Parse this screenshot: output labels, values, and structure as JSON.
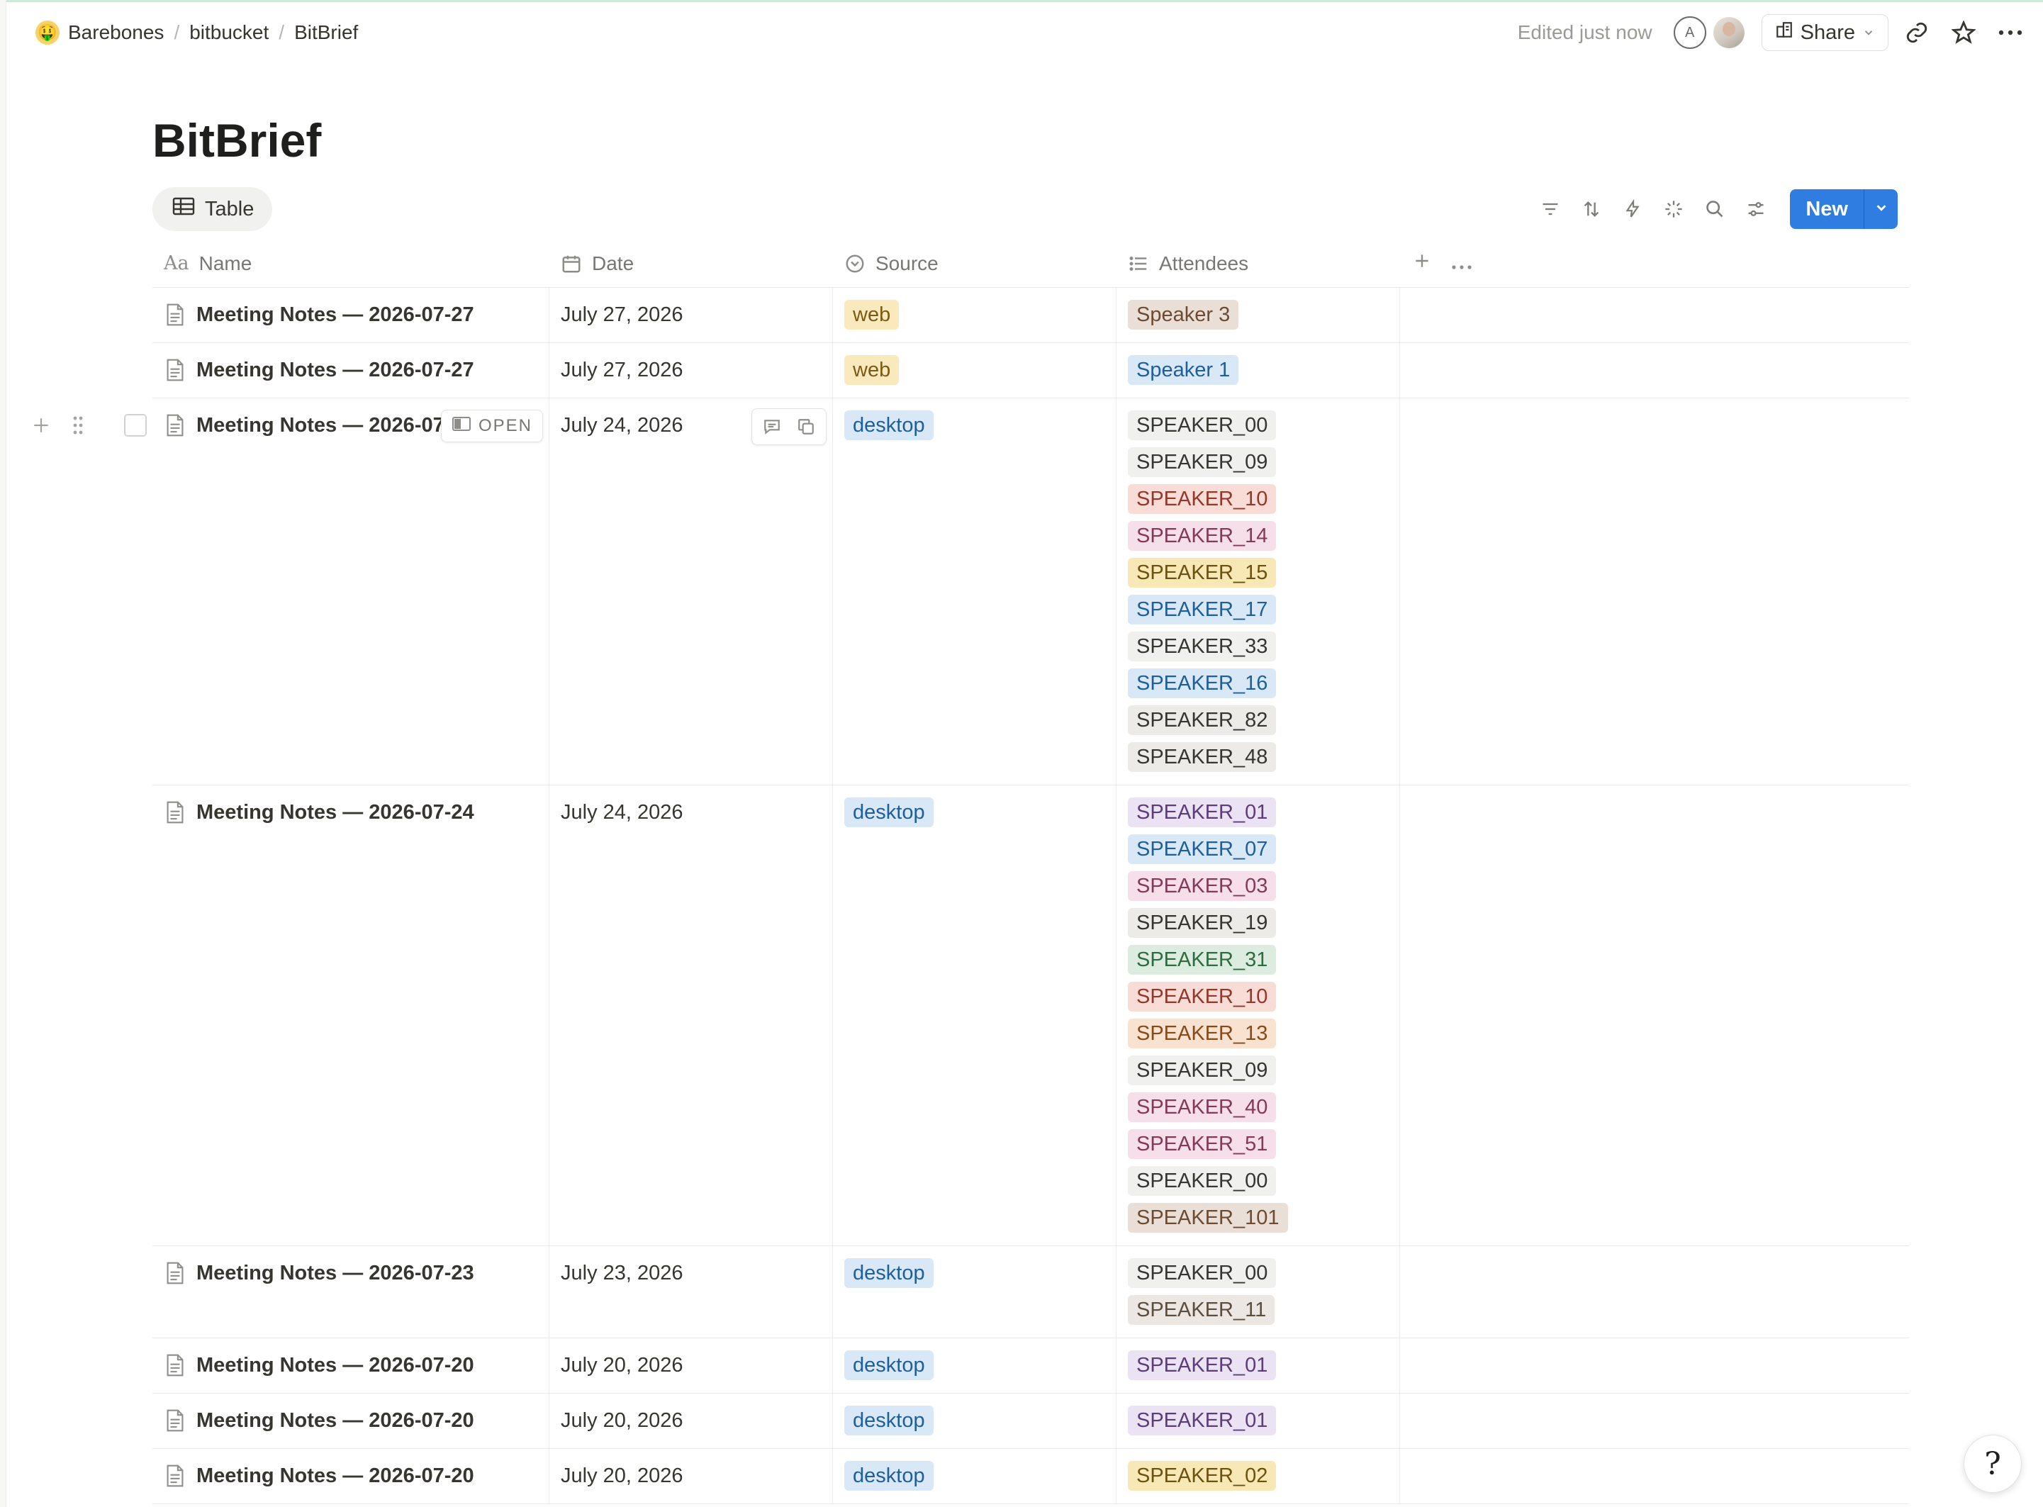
{
  "breadcrumbs": [
    {
      "label": "Barebones",
      "emoji": "🤑"
    },
    {
      "label": "bitbucket"
    },
    {
      "label": "BitBrief"
    }
  ],
  "topbar": {
    "edited": "Edited just now",
    "avatar_initial": "A",
    "share_label": "Share"
  },
  "page": {
    "title": "BitBrief",
    "view_tab": "Table",
    "new_label": "New"
  },
  "columns": {
    "name": "Name",
    "date": "Date",
    "source": "Source",
    "attendees": "Attendees",
    "name_prefix": "Aa"
  },
  "hover": {
    "open_label": "OPEN"
  },
  "rows": [
    {
      "name": "Meeting Notes — 2026-07-27",
      "date": "July 27, 2026",
      "source": "web",
      "attendees": [
        "Speaker 3"
      ]
    },
    {
      "name": "Meeting Notes — 2026-07-27",
      "date": "July 27, 2026",
      "source": "web",
      "attendees": [
        "Speaker 1"
      ]
    },
    {
      "name": "Meeting Notes — 2026-07",
      "date": "July 24, 2026",
      "source": "desktop",
      "attendees": [
        "SPEAKER_00",
        "SPEAKER_09",
        "SPEAKER_10",
        "SPEAKER_14",
        "SPEAKER_15",
        "SPEAKER_17",
        "SPEAKER_33",
        "SPEAKER_16",
        "SPEAKER_82",
        "SPEAKER_48"
      ]
    },
    {
      "name": "Meeting Notes — 2026-07-24",
      "date": "July 24, 2026",
      "source": "desktop",
      "attendees": [
        "SPEAKER_01",
        "SPEAKER_07",
        "SPEAKER_03",
        "SPEAKER_19",
        "SPEAKER_31",
        "SPEAKER_10",
        "SPEAKER_13",
        "SPEAKER_09",
        "SPEAKER_40",
        "SPEAKER_51",
        "SPEAKER_00",
        "SPEAKER_101"
      ]
    },
    {
      "name": "Meeting Notes — 2026-07-23",
      "date": "July 23, 2026",
      "source": "desktop",
      "attendees": [
        "SPEAKER_00",
        "SPEAKER_11"
      ]
    },
    {
      "name": "Meeting Notes — 2026-07-20",
      "date": "July 20, 2026",
      "source": "desktop",
      "attendees": [
        "SPEAKER_01"
      ]
    },
    {
      "name": "Meeting Notes — 2026-07-20",
      "date": "July 20, 2026",
      "source": "desktop",
      "attendees": [
        "SPEAKER_01"
      ]
    },
    {
      "name": "Meeting Notes — 2026-07-20",
      "date": "July 20, 2026",
      "source": "desktop",
      "attendees": [
        "SPEAKER_02"
      ]
    }
  ],
  "tag_colors": {
    "web": {
      "bg": "#f9e9bd",
      "fg": "#7a5a14"
    },
    "desktop": {
      "bg": "#d9e8f7",
      "fg": "#1f5e99"
    },
    "Speaker 3": {
      "bg": "#eadfd6",
      "fg": "#6e4a33"
    },
    "Speaker 1": {
      "bg": "#d9e8f7",
      "fg": "#1f5e99"
    },
    "SPEAKER_00": {
      "bg": "#f0f0ee",
      "fg": "#37352f"
    },
    "SPEAKER_01": {
      "bg": "#ebe2f3",
      "fg": "#5c3d7a"
    },
    "SPEAKER_02": {
      "bg": "#f7e8b6",
      "fg": "#6c5210"
    },
    "SPEAKER_03": {
      "bg": "#f6dfe8",
      "fg": "#84385a"
    },
    "SPEAKER_07": {
      "bg": "#d9e8f7",
      "fg": "#1f5e99"
    },
    "SPEAKER_09": {
      "bg": "#f0f0ee",
      "fg": "#37352f"
    },
    "SPEAKER_10": {
      "bg": "#fadcd6",
      "fg": "#93372b"
    },
    "SPEAKER_11": {
      "bg": "#ece7e2",
      "fg": "#5d4d3e"
    },
    "SPEAKER_13": {
      "bg": "#f9e3d0",
      "fg": "#8a4a17"
    },
    "SPEAKER_14": {
      "bg": "#f6dfe8",
      "fg": "#84385a"
    },
    "SPEAKER_15": {
      "bg": "#f7e8b6",
      "fg": "#6c5210"
    },
    "SPEAKER_16": {
      "bg": "#d9e8f7",
      "fg": "#1f5e99"
    },
    "SPEAKER_17": {
      "bg": "#d9e8f7",
      "fg": "#1f5e99"
    },
    "SPEAKER_19": {
      "bg": "#ecebe8",
      "fg": "#37352f"
    },
    "SPEAKER_31": {
      "bg": "#dcecdf",
      "fg": "#2f6b40"
    },
    "SPEAKER_33": {
      "bg": "#f0f0ee",
      "fg": "#37352f"
    },
    "SPEAKER_40": {
      "bg": "#f6dfe8",
      "fg": "#84385a"
    },
    "SPEAKER_48": {
      "bg": "#ecebe8",
      "fg": "#37352f"
    },
    "SPEAKER_51": {
      "bg": "#f6dfe8",
      "fg": "#84385a"
    },
    "SPEAKER_82": {
      "bg": "#ecebe8",
      "fg": "#37352f"
    },
    "SPEAKER_101": {
      "bg": "#eadfd6",
      "fg": "#6e4a33"
    }
  },
  "colors": {
    "accent": "#2f7de1"
  }
}
